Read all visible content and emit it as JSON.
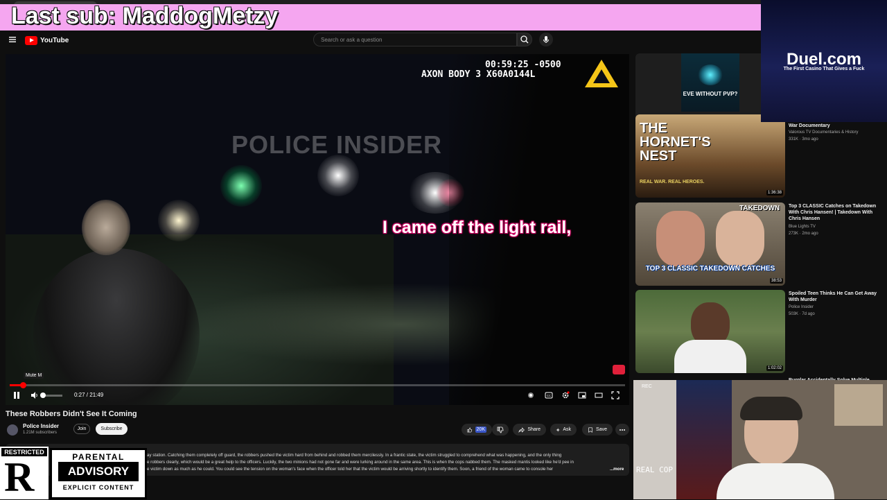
{
  "browser": {
    "tab_title": "These Robbers Didn't See It..."
  },
  "overlay": {
    "sub_banner": "Last sub: MaddogMetzy",
    "sponsor_name": "Duel.com",
    "sponsor_tagline": "The First Casino That Gives a Fuck",
    "advisory_restricted": "RESTRICTED",
    "advisory_r": "R",
    "advisory_top": "PARENTAL",
    "advisory_mid": "ADVISORY",
    "advisory_bottom": "EXPLICIT CONTENT",
    "webcam_rec": "REC",
    "webcam_real_cop": "REAL COP"
  },
  "header": {
    "logo_text": "YouTube",
    "search_placeholder": "Search or ask a question"
  },
  "video": {
    "bodycam_time": "00:59:25 -0500",
    "bodycam_id": "AXON BODY 3 X60A0144L",
    "watermark": "POLICE INSIDER",
    "caption": "I came off the light rail,",
    "mute_tooltip": "Mute  M",
    "time_display": "0:27 / 21:49",
    "progress_fraction": 0.021
  },
  "info": {
    "title": "These Robbers Didn't See It Coming",
    "channel_name": "Police Insider",
    "channel_subs": "1.21M subscribers",
    "join_label": "Join",
    "subscribe_label": "Subscribe",
    "like_count": "20K",
    "share_label": "Share",
    "ask_label": "Ask",
    "save_label": "Save",
    "description_lines": [
      "ay station. Catching them completely off guard, the robbers pushed the victim hard from behind and robbed them mercilessly. In a frantic state, the victim struggled to comprehend what was happening, and the only thing",
      "e robbers clearly, which would be a great help to the officers. Luckily, the two minions had not gone far and were lurking around in the same area. This is when the cops nabbed them. The masked mantis looked like he'd pee in",
      "e victim down as much as he could. You could see the tension on the woman's face when the officer told her that the victim would be arriving shortly to identify them. Soon, a friend of the woman came to console her"
    ],
    "description_more": "...more"
  },
  "sidebar": {
    "items": [
      {
        "title": "War Documentary",
        "channel": "Valorous TV Documentaries & History",
        "meta": "331K · 3mo ago",
        "thumb_title": "THE HORNET'S NEST",
        "thumb_sub": "REAL WAR. REAL HEROES.",
        "duration": "1:36:38"
      },
      {
        "title": "Top 3 CLASSIC Catches on Takedown With Chris Hansen! | Takedown With Chris Hansen",
        "channel": "Blue Lights TV",
        "meta": "273K · 2mo ago",
        "thumb_title": "TOP 3 CLASSIC TAKEDOWN CATCHES",
        "thumb_sub": "TAKEDOWN",
        "duration": "38:53"
      },
      {
        "title": "Spoiled Teen Thinks He Can Get Away With Murder",
        "channel": "Police Insider",
        "meta": "503K · 7d ago",
        "thumb_title": "",
        "thumb_sub": "",
        "duration": "1:02:02"
      }
    ],
    "promo_thumb_text": "EVE WITHOUT PVP?",
    "bottom_partial_title": "Burglar Accidentally Solve Multiple"
  }
}
